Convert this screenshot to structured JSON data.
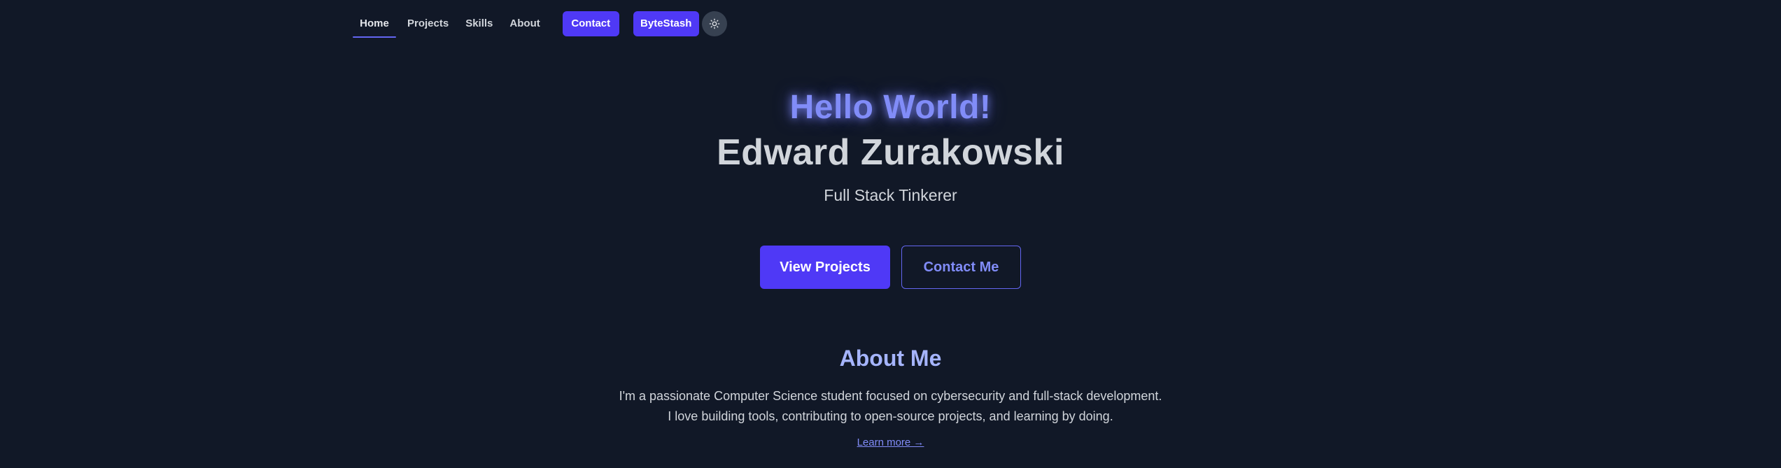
{
  "nav": {
    "links": [
      {
        "label": "Home",
        "active": true
      },
      {
        "label": "Projects",
        "active": false
      },
      {
        "label": "Skills",
        "active": false
      },
      {
        "label": "About",
        "active": false
      }
    ],
    "contact_button": "Contact",
    "bytestash_button": "ByteStash",
    "theme_toggle_icon": "sun-icon"
  },
  "hero": {
    "greeting": "Hello World!",
    "name": "Edward Zurakowski",
    "tagline": "Full Stack Tinkerer",
    "primary_button": "View Projects",
    "secondary_button": "Contact Me"
  },
  "about": {
    "title": "About Me",
    "line1": "I'm a passionate Computer Science student focused on cybersecurity and full-stack development.",
    "line2": "I love building tools, contributing to open-source projects, and learning by doing.",
    "link": "Learn more →"
  },
  "colors": {
    "background": "#111827",
    "accent": "#4f39f6",
    "accent_light": "#818cf8",
    "text": "#d1d5db"
  }
}
